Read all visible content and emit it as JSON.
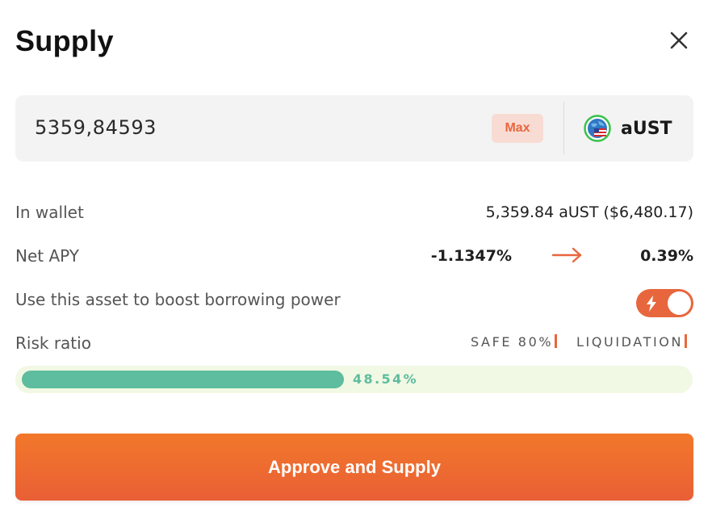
{
  "dialog": {
    "title": "Supply"
  },
  "input": {
    "amount": "5359,84593",
    "max_label": "Max",
    "token_symbol": "aUST",
    "token_icon": "globe-flag-icon"
  },
  "details": {
    "wallet_label": "In wallet",
    "wallet_value": "5,359.84 aUST ($6,480.17)",
    "apy_label": "Net APY",
    "apy_from": "-1.1347%",
    "apy_to": "0.39%",
    "collateral_label": "Use this asset to boost borrowing power",
    "collateral_enabled": true,
    "risk_label": "Risk ratio",
    "safe_label": "SAFE 80%",
    "liquidation_label": "LIQUIDATION",
    "risk_value": "48.54%",
    "risk_fraction": 0.4854
  },
  "actions": {
    "approve_label": "Approve and Supply"
  },
  "colors": {
    "accent": "#e8663d",
    "risk_fill": "#5dbd9e",
    "risk_track": "#f1f8e4",
    "input_bg": "#f3f3f3"
  }
}
